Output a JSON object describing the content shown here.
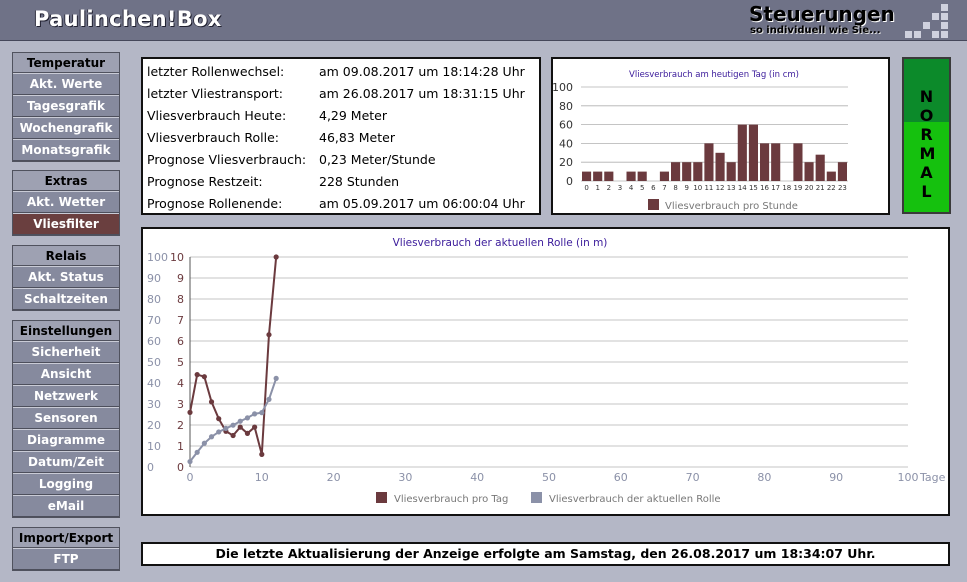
{
  "header": {
    "logo": "Paulinchen!Box",
    "brand_title": "Steuerungen",
    "brand_sub": "so individuell wie Sie..."
  },
  "menu": [
    {
      "title": "Temperatur",
      "items": [
        "Akt. Werte",
        "Tagesgrafik",
        "Wochengrafik",
        "Monatsgrafik"
      ]
    },
    {
      "title": "Extras",
      "items": [
        "Akt. Wetter",
        "Vliesfilter"
      ]
    },
    {
      "title": "Relais",
      "items": [
        "Akt. Status",
        "Schaltzeiten"
      ]
    },
    {
      "title": "Einstellungen",
      "items": [
        "Sicherheit",
        "Ansicht",
        "Netzwerk",
        "Sensoren",
        "Diagramme",
        "Datum/Zeit",
        "Logging",
        "eMail"
      ]
    },
    {
      "title": "Import/Export",
      "items": [
        "FTP"
      ]
    }
  ],
  "active_menu_item": "Vliesfilter",
  "info": [
    {
      "label": "letzter Rollenwechsel:",
      "value": "am 09.08.2017 um 18:14:28 Uhr"
    },
    {
      "label": "letzter Vliestransport:",
      "value": "am 26.08.2017 um 18:31:15 Uhr"
    },
    {
      "label": "Vliesverbrauch Heute:",
      "value": "4,29 Meter"
    },
    {
      "label": "Vliesverbrauch Rolle:",
      "value": "46,83 Meter"
    },
    {
      "label": "Prognose Vliesverbrauch:",
      "value": "0,23 Meter/Stunde"
    },
    {
      "label": "Prognose Restzeit:",
      "value": "228 Stunden"
    },
    {
      "label": "Prognose Rollenende:",
      "value": "am 05.09.2017 um 06:00:04 Uhr"
    }
  ],
  "status": {
    "text": "NORMAL",
    "color_dark": "#0c8a2a",
    "color_light": "#15c10e"
  },
  "update_text": "Die letzte Aktualisierung der Anzeige erfolgte am Samstag, den 26.08.2017 um 18:34:07 Uhr.",
  "colors": {
    "series_day": "#6b3a3e",
    "series_roll": "#8b91a8",
    "title": "#3a1a9a",
    "grid": "#b0b0b0"
  },
  "chart_data": [
    {
      "type": "bar",
      "title": "Vliesverbrauch am heutigen Tag (in cm)",
      "categories": [
        "0",
        "1",
        "2",
        "3",
        "4",
        "5",
        "6",
        "7",
        "8",
        "9",
        "10",
        "11",
        "12",
        "13",
        "14",
        "15",
        "16",
        "17",
        "18",
        "19",
        "20",
        "21",
        "22",
        "23"
      ],
      "series": [
        {
          "name": "Vliesverbrauch pro Stunde",
          "values": [
            10,
            10,
            10,
            0,
            10,
            10,
            0,
            10,
            20,
            20,
            20,
            40,
            30,
            20,
            60,
            60,
            40,
            40,
            0,
            40,
            20,
            28,
            10,
            20
          ]
        }
      ],
      "ylim": [
        0,
        100
      ],
      "yticks": [
        0,
        20,
        40,
        60,
        80,
        100
      ],
      "legend": "bottom",
      "grid": true
    },
    {
      "type": "line",
      "title": "Vliesverbrauch der aktuellen Rolle (in m)",
      "x_label": "Tage",
      "xlim": [
        0,
        100
      ],
      "xticks": [
        0,
        10,
        20,
        30,
        40,
        50,
        60,
        70,
        80,
        90,
        100
      ],
      "ylim": [
        0,
        10
      ],
      "yticks_left": [
        0,
        10,
        20,
        30,
        40,
        50,
        60,
        70,
        80,
        90,
        100
      ],
      "yticks_right": [
        0,
        1,
        2,
        3,
        4,
        5,
        6,
        7,
        8,
        9,
        10
      ],
      "series": [
        {
          "name": "Vliesverbrauch pro Tag",
          "axis": "right",
          "x": [
            0,
            1,
            2,
            3,
            4,
            5,
            6,
            7,
            8,
            9,
            10,
            11,
            12
          ],
          "y": [
            2.6,
            4.4,
            4.3,
            3.1,
            2.3,
            1.7,
            1.5,
            1.9,
            1.6,
            1.9,
            0.6,
            6.3,
            10
          ]
        },
        {
          "name": "Vliesverbrauch der aktuellen Rolle",
          "axis": "left",
          "x": [
            0,
            1,
            2,
            3,
            4,
            5,
            6,
            7,
            8,
            9,
            10,
            11,
            12
          ],
          "y": [
            2.6,
            7,
            11.3,
            14.4,
            16.7,
            18.4,
            19.9,
            21.8,
            23.4,
            25.3,
            25.9,
            32.2,
            42.2
          ]
        }
      ],
      "legend": "bottom",
      "grid": true
    }
  ]
}
